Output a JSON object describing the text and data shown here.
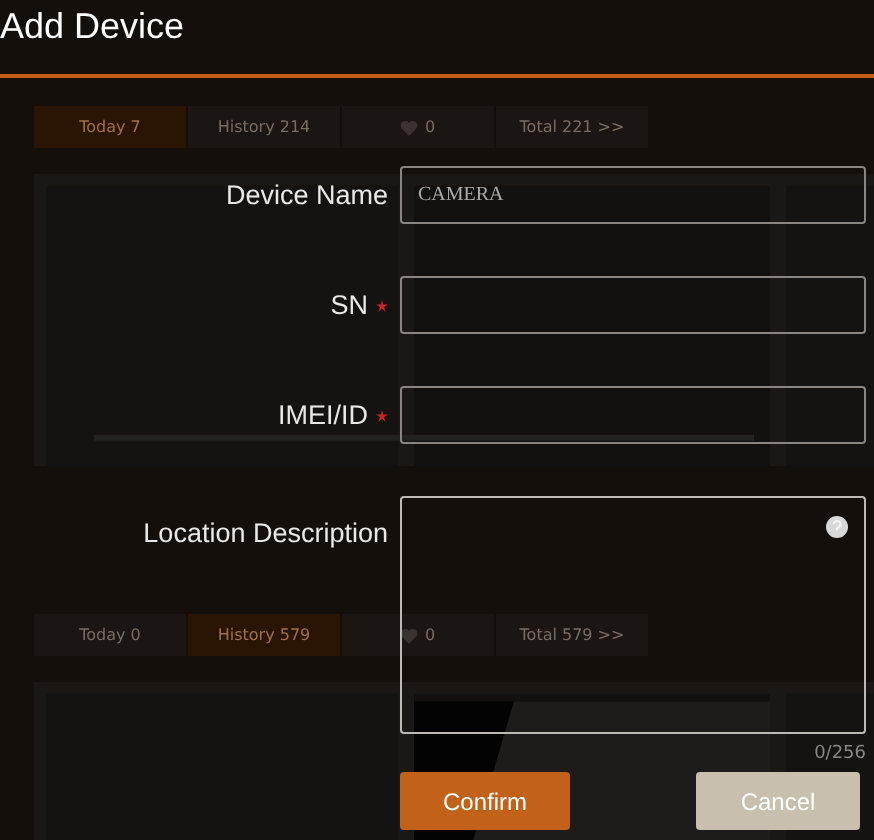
{
  "window": {
    "title": "Add Device"
  },
  "background_panels": [
    {
      "tabs": [
        {
          "label": "Today 7",
          "selected": true
        },
        {
          "label": "History 214",
          "selected": false
        },
        {
          "label": "0",
          "kind": "favorite",
          "selected": false
        },
        {
          "label": "Total 221 >>",
          "selected": false
        }
      ]
    },
    {
      "tabs": [
        {
          "label": "Today 0",
          "selected": false
        },
        {
          "label": "History 579",
          "selected": true
        },
        {
          "label": "0",
          "kind": "favorite",
          "selected": false
        },
        {
          "label": "Total 579 >>",
          "selected": false
        }
      ]
    }
  ],
  "form": {
    "fields": [
      {
        "label": "Device Name",
        "required": false,
        "value": "CAMERA",
        "kind": "text"
      },
      {
        "label": "SN",
        "required": true,
        "kind": "text"
      },
      {
        "label": "IMEI/ID",
        "required": true,
        "kind": "text"
      },
      {
        "label": "Location Description",
        "required": false,
        "kind": "textarea",
        "counter": "0/256"
      }
    ]
  },
  "buttons": [
    {
      "label": "Confirm",
      "kind": "primary"
    },
    {
      "label": "Cancel",
      "kind": "secondary"
    }
  ]
}
